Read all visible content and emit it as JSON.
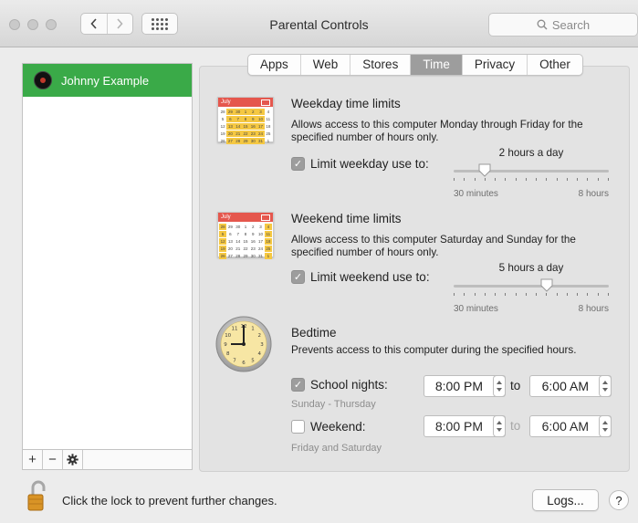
{
  "window": {
    "title": "Parental Controls"
  },
  "search": {
    "placeholder": "Search"
  },
  "sidebar": {
    "users": [
      {
        "name": "Johnny Example",
        "selected": true
      }
    ]
  },
  "tabs": [
    {
      "label": "Apps",
      "active": false
    },
    {
      "label": "Web",
      "active": false
    },
    {
      "label": "Stores",
      "active": false
    },
    {
      "label": "Time",
      "active": true
    },
    {
      "label": "Privacy",
      "active": false
    },
    {
      "label": "Other",
      "active": false
    }
  ],
  "weekday": {
    "title": "Weekday time limits",
    "description": "Allows access to this computer Monday through Friday for the specified number of hours only.",
    "checkbox_label": "Limit weekday use to:",
    "checked": true,
    "value_label": "2 hours a day",
    "min_label": "30 minutes",
    "max_label": "8 hours",
    "value_hours": 2
  },
  "weekend": {
    "title": "Weekend time limits",
    "description": "Allows access to this computer Saturday and Sunday for the specified number of hours only.",
    "checkbox_label": "Limit weekend use to:",
    "checked": true,
    "value_label": "5 hours a day",
    "min_label": "30 minutes",
    "max_label": "8 hours",
    "value_hours": 5
  },
  "bedtime": {
    "title": "Bedtime",
    "description": "Prevents access to this computer during the specified hours.",
    "school_nights": {
      "label": "School nights:",
      "checked": true,
      "days": "Sunday - Thursday",
      "from": "8:00 PM",
      "to_word": "to",
      "to": "6:00 AM"
    },
    "weekend": {
      "label": "Weekend:",
      "checked": false,
      "days": "Friday and Saturday",
      "from": "8:00 PM",
      "to_word": "to",
      "to": "6:00 AM"
    }
  },
  "calendar": {
    "month": "July",
    "days": [
      "28",
      "29",
      "30",
      "1",
      "2",
      "3",
      "4",
      "5",
      "6",
      "7",
      "8",
      "9",
      "10",
      "11",
      "12",
      "13",
      "14",
      "15",
      "16",
      "17",
      "18",
      "19",
      "20",
      "21",
      "22",
      "23",
      "24",
      "25",
      "26",
      "27",
      "28",
      "29",
      "30",
      "31",
      "1"
    ]
  },
  "clock": {
    "numerals": [
      "12",
      "1",
      "2",
      "3",
      "4",
      "5",
      "6",
      "7",
      "8",
      "9",
      "10",
      "11"
    ]
  },
  "footer": {
    "lock_text": "Click the lock to prevent further changes.",
    "logs_label": "Logs...",
    "help_label": "?"
  },
  "colors": {
    "selection_green": "#3aaa48",
    "active_tab": "#9d9d9d",
    "calendar_red": "#e5574d",
    "calendar_highlight": "#f5c842",
    "clock_face": "#f7e6a4"
  },
  "sidebar_tools": {
    "add_icon": "+",
    "remove_icon": "−",
    "gear_icon": "✱"
  }
}
